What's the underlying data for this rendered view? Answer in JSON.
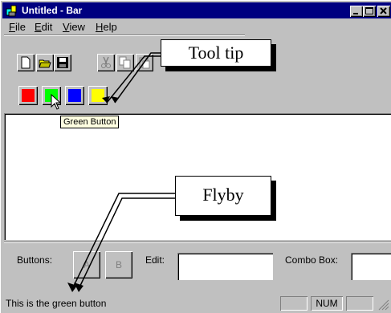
{
  "window": {
    "title": "Untitled - Bar"
  },
  "caption_buttons": [
    "minimize",
    "maximize",
    "close"
  ],
  "menu": [
    {
      "label": "File",
      "underline": "F",
      "rest": "ile"
    },
    {
      "label": "Edit",
      "underline": "E",
      "rest": "dit"
    },
    {
      "label": "View",
      "underline": "V",
      "rest": "iew"
    },
    {
      "label": "Help",
      "underline": "H",
      "rest": "elp"
    }
  ],
  "toolbar": {
    "icons": [
      "new-file-icon",
      "open-folder-icon",
      "save-disk-icon",
      "cut-scissors-icon",
      "copy-icon",
      "paste-icon"
    ]
  },
  "colorbar": {
    "buttons": [
      {
        "name": "red",
        "color": "#ff0000"
      },
      {
        "name": "green",
        "color": "#00ff00"
      },
      {
        "name": "blue",
        "color": "#0000ff"
      },
      {
        "name": "yellow",
        "color": "#ffff00"
      }
    ],
    "tooltip": "Green Button"
  },
  "callouts": {
    "tooltip": "Tool tip",
    "flyby": "Flyby"
  },
  "dialogbar": {
    "buttons_label": "Buttons:",
    "button_a": "A",
    "button_b": "B",
    "edit_label": "Edit:",
    "combo_label": "Combo Box:"
  },
  "statusbar": {
    "message": "This is the green button",
    "num": "NUM"
  }
}
